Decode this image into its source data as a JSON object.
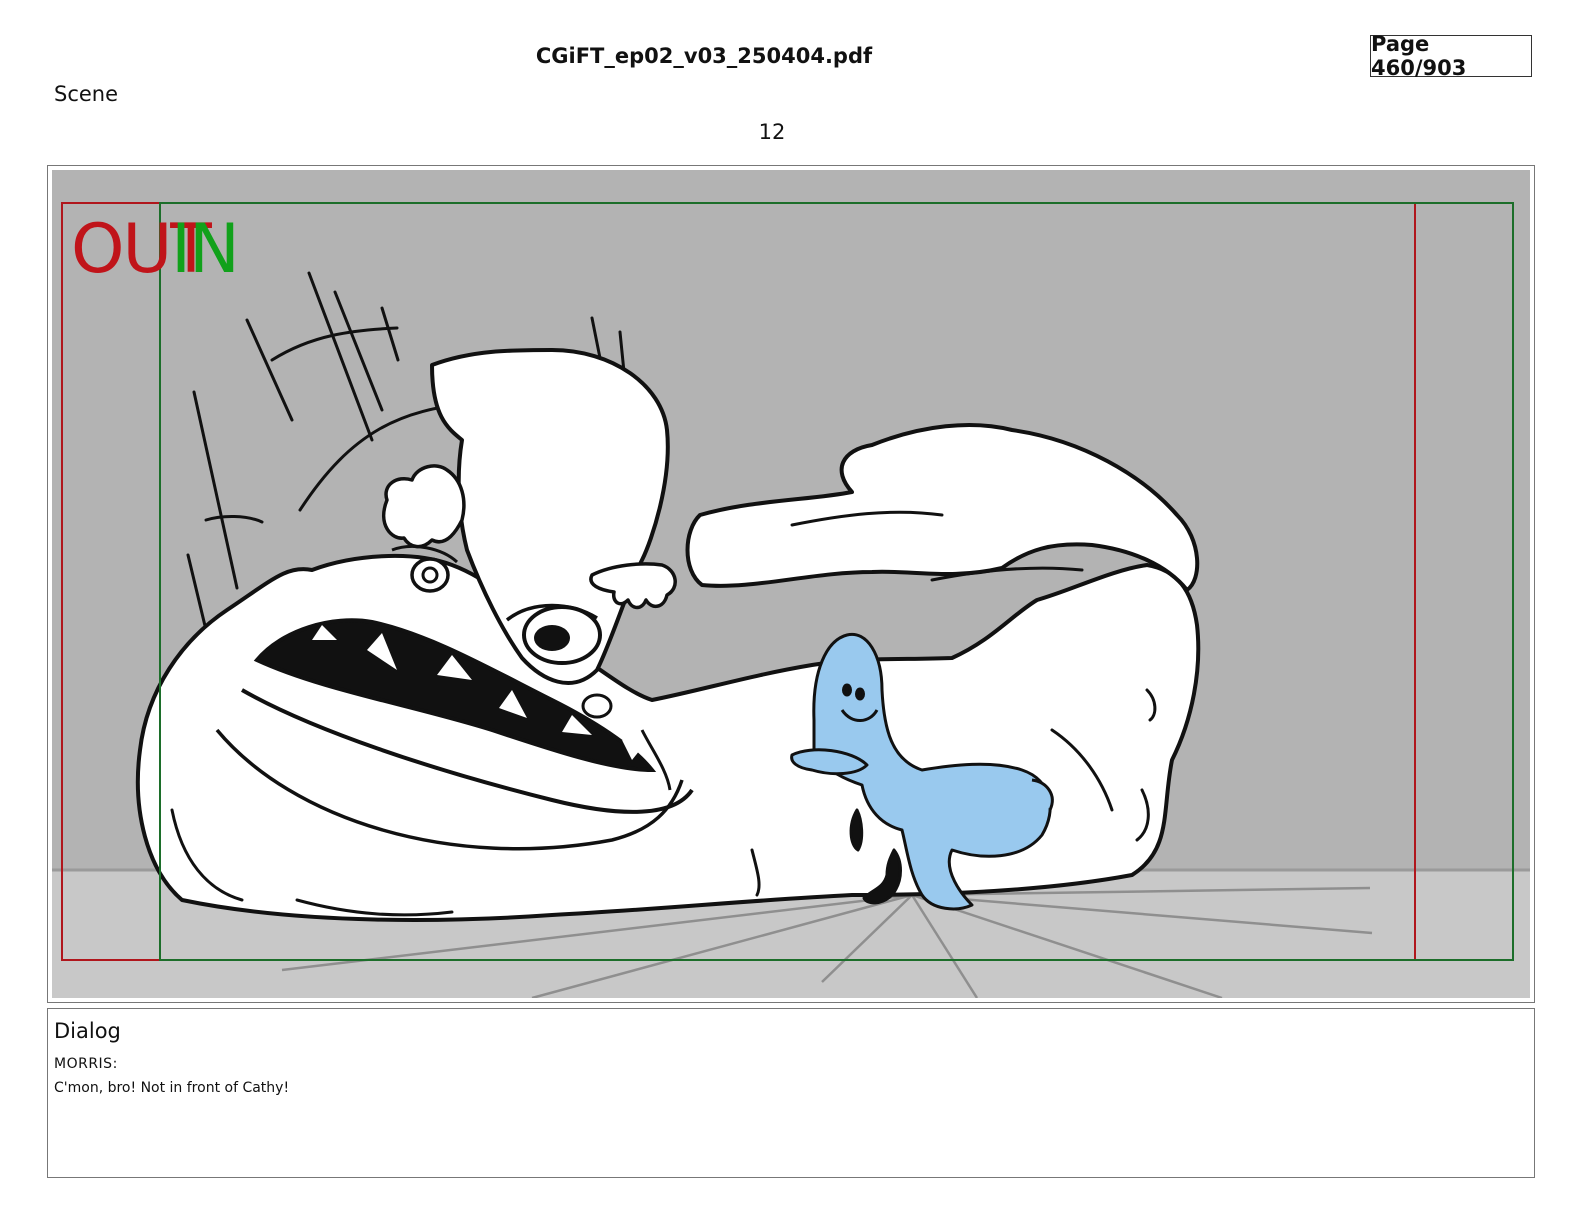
{
  "header": {
    "document_title": "CGiFT_ep02_v03_250404.pdf",
    "page_label": "Page 460/903"
  },
  "scene": {
    "label": "Scene",
    "number": "12"
  },
  "panel": {
    "safe_frame_out_label": "OUT",
    "safe_frame_in_label": "IN",
    "colors": {
      "background": "#b3b3b3",
      "floor": "#c8c8c8",
      "out_frame": "#b0161c",
      "in_frame": "#1c6e2a",
      "character_blue": "#99c9ee"
    }
  },
  "dialog": {
    "title": "Dialog",
    "speaker": "MORRIS:",
    "line": "C'mon, bro! Not in front of Cathy!"
  }
}
